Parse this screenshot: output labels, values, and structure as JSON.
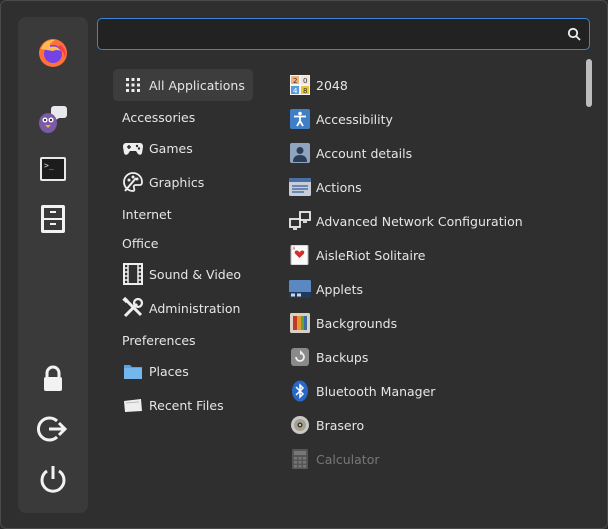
{
  "search": {
    "value": "",
    "placeholder": ""
  },
  "favorites": {
    "top": [
      "firefox-icon",
      "pidgin-icon",
      "terminal-icon",
      "file-manager-icon"
    ],
    "bottom": [
      "lock-icon",
      "logout-icon",
      "power-icon"
    ]
  },
  "categories": [
    {
      "label": "All Applications",
      "icon": "grid-icon",
      "active": true
    },
    {
      "label": "Accessories",
      "icon": ""
    },
    {
      "label": "Games",
      "icon": "gamepad-icon"
    },
    {
      "label": "Graphics",
      "icon": "palette-icon"
    },
    {
      "label": "Internet",
      "icon": ""
    },
    {
      "label": "Office",
      "icon": ""
    },
    {
      "label": "Sound & Video",
      "icon": "film-icon"
    },
    {
      "label": "Administration",
      "icon": "tools-icon"
    },
    {
      "label": "Preferences",
      "icon": ""
    },
    {
      "label": "Places",
      "icon": "folder-icon"
    },
    {
      "label": "Recent Files",
      "icon": "recent-files-icon"
    }
  ],
  "apps": [
    {
      "label": "2048",
      "icon": "2048-icon"
    },
    {
      "label": "Accessibility",
      "icon": "accessibility-icon"
    },
    {
      "label": "Account details",
      "icon": "account-icon"
    },
    {
      "label": "Actions",
      "icon": "actions-icon"
    },
    {
      "label": "Advanced Network Configuration",
      "icon": "network-icon"
    },
    {
      "label": "AisleRiot Solitaire",
      "icon": "cards-icon"
    },
    {
      "label": "Applets",
      "icon": "applets-icon"
    },
    {
      "label": "Backgrounds",
      "icon": "backgrounds-icon"
    },
    {
      "label": "Backups",
      "icon": "backups-icon"
    },
    {
      "label": "Bluetooth Manager",
      "icon": "bluetooth-icon"
    },
    {
      "label": "Brasero",
      "icon": "disc-icon"
    },
    {
      "label": "Calculator",
      "icon": "calculator-icon",
      "dim": true
    }
  ]
}
